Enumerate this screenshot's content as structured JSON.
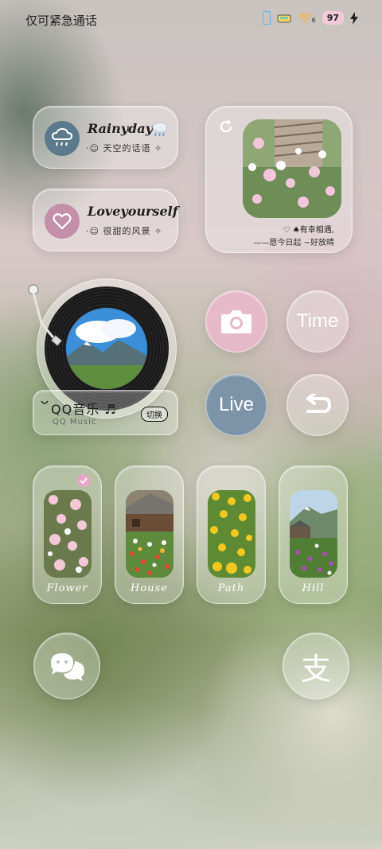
{
  "status_bar": {
    "carrier": "仅可紧急通话",
    "battery": "97",
    "wifi_label": "6"
  },
  "weather_widget": {
    "title": "Rainyday",
    "subtitle": "·☺ 天空的话语 ✧",
    "icon": "cloud-rain-icon",
    "accent": "#5b7a8c"
  },
  "love_widget": {
    "title": "Loveyourself",
    "subtitle": "·☺ 很甜的风景 ✧",
    "icon": "heart-icon",
    "accent": "#c48fa9"
  },
  "photo_widget": {
    "quote_line1": "♡ ♠有幸相遇,",
    "quote_line2": "——愿今日起 ~好放晴"
  },
  "music_widget": {
    "title": "QQ音乐 ♬",
    "subtitle": "QQ Music",
    "switch_label": "切换"
  },
  "round_buttons": {
    "camera": {
      "icon": "camera-icon",
      "color": "#e6b9c8"
    },
    "time": {
      "label": "Time"
    },
    "live": {
      "label": "Live",
      "color": "#7d93a8"
    },
    "back": {
      "icon": "back-arrow-icon"
    }
  },
  "cards": [
    {
      "label": "Flower",
      "selected": true
    },
    {
      "label": "House"
    },
    {
      "label": "Path"
    },
    {
      "label": "Hill"
    }
  ],
  "dock": {
    "wechat": {
      "icon": "chat-bubbles-icon"
    },
    "alipay": {
      "label": "支"
    }
  }
}
